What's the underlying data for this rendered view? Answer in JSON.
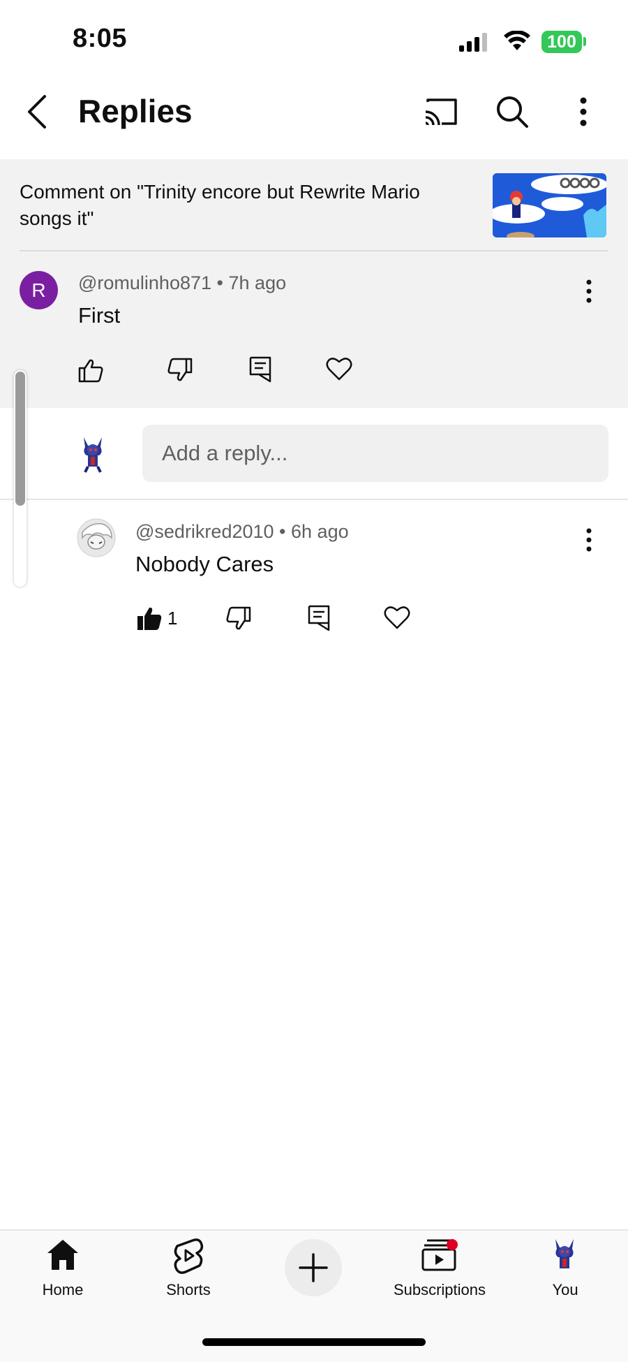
{
  "status_bar": {
    "time": "8:05",
    "battery": "100"
  },
  "header": {
    "title": "Replies"
  },
  "context": {
    "text": "Comment on \"Trinity encore but Rewrite Mario songs it\""
  },
  "parent_comment": {
    "avatar_letter": "R",
    "author": "@romulinho871",
    "time": "7h ago",
    "text": "First"
  },
  "reply_box": {
    "placeholder": "Add a reply..."
  },
  "replies": [
    {
      "author": "@sedrikred2010",
      "time": "6h ago",
      "text": "Nobody Cares",
      "likes": "1"
    }
  ],
  "bottom_nav": {
    "home": "Home",
    "shorts": "Shorts",
    "subscriptions": "Subscriptions",
    "you": "You"
  },
  "colors": {
    "avatar_r": "#7b1fa2",
    "battery": "#34c759",
    "notification_dot": "#e00025"
  },
  "icons": [
    "back-arrow-icon",
    "cast-icon",
    "search-icon",
    "more-vertical-icon",
    "thumb-up-icon",
    "thumb-down-icon",
    "reply-icon",
    "heart-icon",
    "home-icon",
    "shorts-icon",
    "create-plus-icon",
    "subscriptions-icon"
  ]
}
